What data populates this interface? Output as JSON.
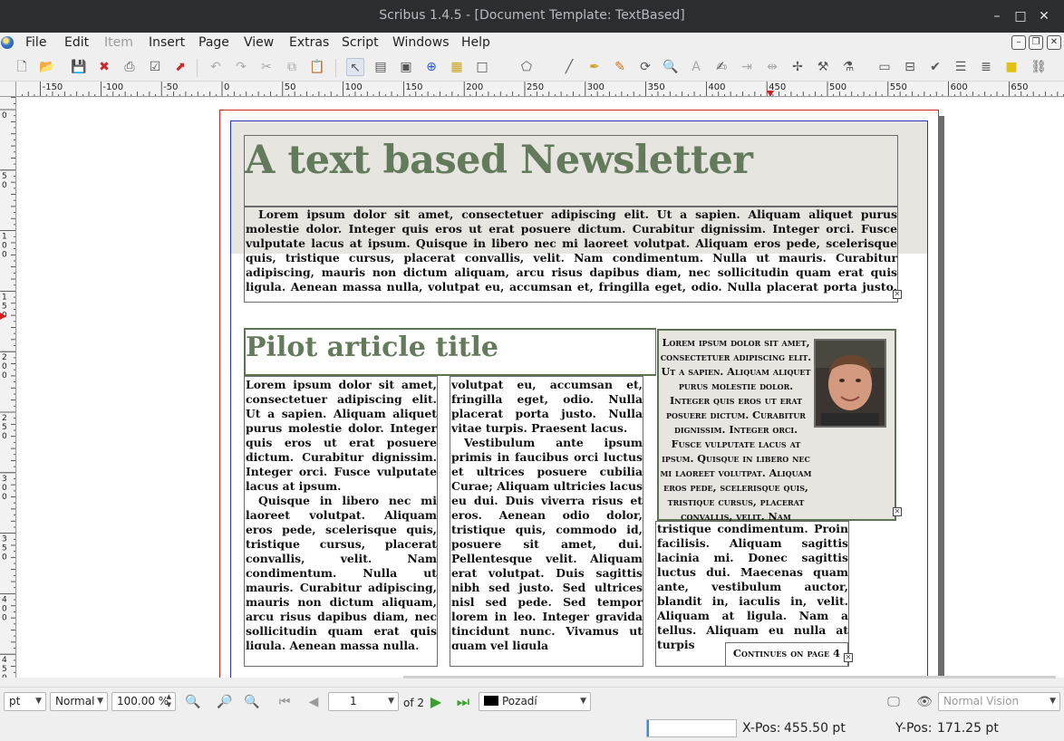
{
  "window": {
    "title": "Scribus 1.4.5 - [Document Template: TextBased]",
    "controls": {
      "minimize": "–",
      "maximize": "□",
      "close": "✕"
    }
  },
  "menubar": {
    "items": [
      {
        "label": "File",
        "enabled": true
      },
      {
        "label": "Edit",
        "enabled": true
      },
      {
        "label": "Item",
        "enabled": false
      },
      {
        "label": "Insert",
        "enabled": true
      },
      {
        "label": "Page",
        "enabled": true
      },
      {
        "label": "View",
        "enabled": true
      },
      {
        "label": "Extras",
        "enabled": true
      },
      {
        "label": "Script",
        "enabled": true
      },
      {
        "label": "Windows",
        "enabled": true
      },
      {
        "label": "Help",
        "enabled": true
      }
    ],
    "mdi_controls": {
      "minimize": "–",
      "restore": "❐",
      "close": "✕"
    }
  },
  "toolbar": {
    "icons": [
      "new-document-icon",
      "open-icon",
      "save-icon",
      "close-document-icon",
      "print-icon",
      "preflight-icon",
      "export-pdf-icon",
      "undo-icon",
      "redo-icon",
      "cut-icon",
      "copy-icon",
      "paste-icon",
      "select-icon",
      "text-frame-icon",
      "image-frame-icon",
      "render-frame-icon",
      "table-icon",
      "shape-icon",
      "polygon-icon",
      "line-icon",
      "bezier-icon",
      "freehand-icon",
      "rotate-icon",
      "zoom-icon",
      "edit-text-icon",
      "story-editor-icon",
      "link-frames-icon",
      "unlink-frames-icon",
      "measure-icon",
      "copy-properties-icon",
      "eyedropper-icon",
      "pdf-button-icon",
      "pdf-textfield-icon",
      "pdf-checkbox-icon",
      "pdf-combobox-icon",
      "pdf-listbox-icon",
      "pdf-annotation-icon",
      "pdf-link-icon"
    ]
  },
  "ruler": {
    "labels": [
      "-150",
      "-100",
      "-50",
      "0",
      "50",
      "100",
      "150",
      "200",
      "250",
      "300",
      "350",
      "400",
      "450",
      "500",
      "550",
      "600",
      "650"
    ],
    "vertical_labels": [
      "0",
      "50",
      "100",
      "150",
      "200",
      "250",
      "300",
      "350",
      "400",
      "450"
    ]
  },
  "document": {
    "newsletter_title": "A text based Newsletter",
    "intro": "Lorem ipsum dolor sit amet, consectetuer adipiscing elit. Ut a sapien. Aliquam aliquet purus molestie dolor. Integer quis eros ut erat posuere dictum. Curabitur dignissim. Integer orci. Fusce vulputate lacus at ipsum. Quisque in libero nec mi laoreet volutpat. Aliquam eros pede, scelerisque quis, tristique cursus, placerat convallis, velit. Nam condimentum. Nulla ut mauris. Curabitur adipiscing, mauris non dictum aliquam, arcu risus dapibus diam, nec sollicitudin quam erat quis ligula. Aenean massa nulla, volutpat eu, accumsan et, fringilla eget, odio. Nulla placerat porta justo. Nulla vitae turpis. Praesent",
    "article_title": "Pilot article title",
    "column1_p1": "Lorem ipsum dolor sit amet, consectetuer adipiscing elit. Ut a sapien. Aliquam aliquet purus molestie dolor. Integer quis eros ut erat posuere dictum. Curabitur dignissim. Integer orci. Fusce vulputate lacus at ipsum.",
    "column1_p2": "Quisque in libero nec mi laoreet volutpat. Aliquam eros pede, scelerisque quis, tristique cursus, placerat convallis, velit. Nam condimentum. Nulla ut mauris. Curabitur adipiscing, mauris non dictum aliquam, arcu risus dapibus diam, nec sollicitudin quam erat quis ligula. Aenean massa nulla,",
    "column2_p1": "volutpat eu, accumsan et, fringilla eget, odio. Nulla placerat porta justo. Nulla vitae turpis. Praesent lacus.",
    "column2_p2": "Vestibulum ante ipsum primis in faucibus orci luctus et ultrices posuere cubilia Curae; Aliquam ultricies lacus eu dui. Duis viverra risus et eros. Aenean odio dolor, tristique quis, commodo id, posuere sit amet, dui. Pellentesque velit. Aliquam erat volutpat. Duis sagittis nibh sed justo. Sed ultrices nisl sed pede. Sed tempor lorem in leo. Integer gravida tincidunt nunc. Vivamus ut quam vel ligula",
    "column3": "tristique condimentum. Proin facilisis. Aliquam sagittis lacinia mi. Donec sagittis luctus dui. Maecenas quam ante, vestibulum auctor, blandit in, iaculis in, velit. Aliquam at ligula. Nam a tellus. Aliquam eu nulla at turpis",
    "sidebar": "Lorem ipsum dolor sit amet, consectetuer adipiscing elit. Ut a sapien. Aliquam aliquet purus molestie dolor. Integer quis eros ut erat posuere dictum. Curabitur dignissim. Integer orci. Fusce vulputate lacus at ipsum. Quisque in libero nec mi laoreet volutpat. Aliquam eros pede, scelerisque quis, tristique cursus, placerat convallis, velit. Nam",
    "continues": "Continues on page 4",
    "colors": {
      "title_green": "#637a5b",
      "band_gray": "#e6e5e0",
      "frame_border_green": "#5d7454"
    }
  },
  "statusbar": {
    "unit": "pt",
    "image_quality": "Normal",
    "zoom": "100.00 %",
    "page_current": "1",
    "page_total": "of 2",
    "layer": "Pozadí",
    "vision_mode": "Normal Vision"
  },
  "coordinates": {
    "progress": 0.02,
    "xpos_label": "X-Pos:",
    "xpos_value": "455.50 pt",
    "ypos_label": "Y-Pos:",
    "ypos_value": "171.25 pt"
  }
}
